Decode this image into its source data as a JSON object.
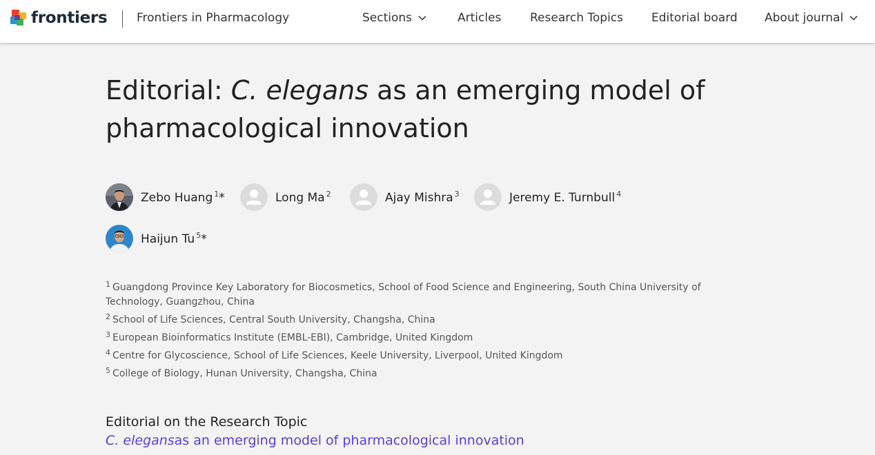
{
  "header": {
    "logo_text": "frontiers",
    "journal_name": "Frontiers in Pharmacology",
    "nav": [
      {
        "label": "Sections",
        "has_dropdown": true
      },
      {
        "label": "Articles",
        "has_dropdown": false
      },
      {
        "label": "Research Topics",
        "has_dropdown": false
      },
      {
        "label": "Editorial board",
        "has_dropdown": false
      },
      {
        "label": "About journal",
        "has_dropdown": true
      }
    ],
    "logo_colors": [
      "#e8412e",
      "#f6b12b",
      "#2a96d4",
      "#3bb15c",
      "#6b3fa0"
    ]
  },
  "article": {
    "title_prefix": "Editorial: ",
    "title_italic": "C. elegans",
    "title_rest": " as an emerging model of pharmacological innovation"
  },
  "authors": [
    {
      "name": "Zebo Huang",
      "affil": "1",
      "corresponding": "*",
      "avatar": "photo"
    },
    {
      "name": "Long Ma",
      "affil": "2",
      "corresponding": "",
      "avatar": "placeholder"
    },
    {
      "name": "Ajay Mishra",
      "affil": "3",
      "corresponding": "",
      "avatar": "placeholder"
    },
    {
      "name": "Jeremy E. Turnbull",
      "affil": "4",
      "corresponding": "",
      "avatar": "placeholder"
    },
    {
      "name": "Haijun Tu",
      "affil": "5",
      "corresponding": "*",
      "avatar": "photo"
    }
  ],
  "affiliations": [
    {
      "num": "1",
      "text": "Guangdong Province Key Laboratory for Biocosmetics, School of Food Science and Engineering, South China University of Technology, Guangzhou, China"
    },
    {
      "num": "2",
      "text": "School of Life Sciences, Central South University, Changsha, China"
    },
    {
      "num": "3",
      "text": "European Bioinformatics Institute (EMBL-EBI), Cambridge, United Kingdom"
    },
    {
      "num": "4",
      "text": "Centre for Glycoscience, School of Life Sciences, Keele University, Liverpool, United Kingdom"
    },
    {
      "num": "5",
      "text": "College of Biology, Hunan University, Changsha, China"
    }
  ],
  "research_topic": {
    "heading": "Editorial on the Research Topic",
    "link_italic": "C. elegans",
    "link_rest": "as an emerging model of pharmacological innovation",
    "link_color": "#5a3fd0"
  }
}
